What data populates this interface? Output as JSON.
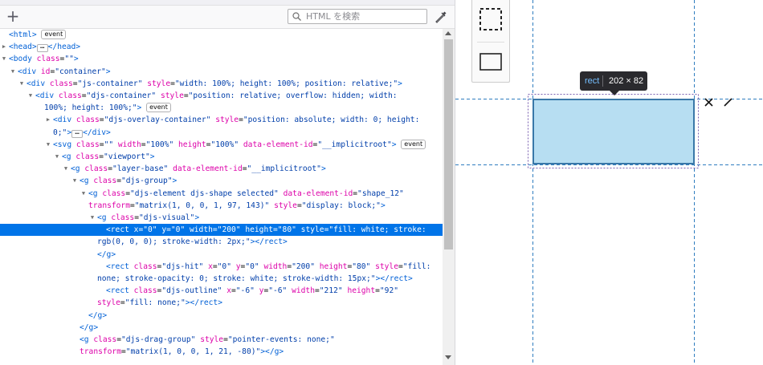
{
  "search": {
    "placeholder": "HTML を検索"
  },
  "tooltip": {
    "tag": "rect",
    "dims": "202 × 82"
  },
  "colors": {
    "selection": "#0074e8",
    "highlight_fill": "#b7def2",
    "guide": "#2f7dbf"
  },
  "lines": [
    [
      [
        "t",
        "<html>"
      ],
      [
        "x",
        " "
      ],
      [
        "b",
        "event"
      ]
    ],
    [
      [
        "t",
        "<head>"
      ],
      [
        "e",
        ""
      ],
      [
        "t",
        "</head>"
      ]
    ],
    [
      [
        "t",
        "<body "
      ],
      [
        "a",
        "class"
      ],
      [
        "p",
        "="
      ],
      [
        "v",
        "\"\""
      ],
      [
        "t",
        ">"
      ]
    ],
    [
      [
        "t",
        "<div "
      ],
      [
        "a",
        "id"
      ],
      [
        "p",
        "="
      ],
      [
        "v",
        "\"container\""
      ],
      [
        "t",
        ">"
      ]
    ],
    [
      [
        "t",
        "<div "
      ],
      [
        "a",
        "class"
      ],
      [
        "p",
        "="
      ],
      [
        "v",
        "\"js-container\""
      ],
      [
        "x",
        " "
      ],
      [
        "a",
        "style"
      ],
      [
        "p",
        "="
      ],
      [
        "v",
        "\"width: 100%; height: 100%; position: relative;\""
      ],
      [
        "t",
        ">"
      ]
    ],
    [
      [
        "t",
        "<div "
      ],
      [
        "a",
        "class"
      ],
      [
        "p",
        "="
      ],
      [
        "v",
        "\"djs-container\""
      ],
      [
        "x",
        " "
      ],
      [
        "a",
        "style"
      ],
      [
        "p",
        "="
      ],
      [
        "v",
        "\"position: relative; overflow: hidden; width:"
      ]
    ],
    [
      [
        "v",
        "100%; height: 100%;\""
      ],
      [
        "t",
        ">"
      ],
      [
        "x",
        " "
      ],
      [
        "b",
        "event"
      ]
    ],
    [
      [
        "t",
        "<div "
      ],
      [
        "a",
        "class"
      ],
      [
        "p",
        "="
      ],
      [
        "v",
        "\"djs-overlay-container\""
      ],
      [
        "x",
        " "
      ],
      [
        "a",
        "style"
      ],
      [
        "p",
        "="
      ],
      [
        "v",
        "\"position: absolute; width: 0; height:"
      ]
    ],
    [
      [
        "v",
        "0;\""
      ],
      [
        "t",
        ">"
      ],
      [
        "e",
        ""
      ],
      [
        "t",
        "</div>"
      ]
    ],
    [
      [
        "t",
        "<svg "
      ],
      [
        "a",
        "class"
      ],
      [
        "p",
        "="
      ],
      [
        "v",
        "\"\""
      ],
      [
        "x",
        " "
      ],
      [
        "a",
        "width"
      ],
      [
        "p",
        "="
      ],
      [
        "v",
        "\"100%\""
      ],
      [
        "x",
        " "
      ],
      [
        "a",
        "height"
      ],
      [
        "p",
        "="
      ],
      [
        "v",
        "\"100%\""
      ],
      [
        "x",
        " "
      ],
      [
        "a",
        "data-element-id"
      ],
      [
        "p",
        "="
      ],
      [
        "v",
        "\"__implicitroot\""
      ],
      [
        "t",
        ">"
      ],
      [
        "x",
        " "
      ],
      [
        "b",
        "event"
      ]
    ],
    [
      [
        "t",
        "<g "
      ],
      [
        "a",
        "class"
      ],
      [
        "p",
        "="
      ],
      [
        "v",
        "\"viewport\""
      ],
      [
        "t",
        ">"
      ]
    ],
    [
      [
        "t",
        "<g "
      ],
      [
        "a",
        "class"
      ],
      [
        "p",
        "="
      ],
      [
        "v",
        "\"layer-base\""
      ],
      [
        "x",
        " "
      ],
      [
        "a",
        "data-element-id"
      ],
      [
        "p",
        "="
      ],
      [
        "v",
        "\"__implicitroot\""
      ],
      [
        "t",
        ">"
      ]
    ],
    [
      [
        "t",
        "<g "
      ],
      [
        "a",
        "class"
      ],
      [
        "p",
        "="
      ],
      [
        "v",
        "\"djs-group\""
      ],
      [
        "t",
        ">"
      ]
    ],
    [
      [
        "t",
        "<g "
      ],
      [
        "a",
        "class"
      ],
      [
        "p",
        "="
      ],
      [
        "v",
        "\"djs-element djs-shape selected\""
      ],
      [
        "x",
        " "
      ],
      [
        "a",
        "data-element-id"
      ],
      [
        "p",
        "="
      ],
      [
        "v",
        "\"shape_12\""
      ]
    ],
    [
      [
        "a",
        "transform"
      ],
      [
        "p",
        "="
      ],
      [
        "v",
        "\"matrix(1, 0, 0, 1, 97, 143)\""
      ],
      [
        "x",
        " "
      ],
      [
        "a",
        "style"
      ],
      [
        "p",
        "="
      ],
      [
        "v",
        "\"display: block;\""
      ],
      [
        "t",
        ">"
      ]
    ],
    [
      [
        "t",
        "<g "
      ],
      [
        "a",
        "class"
      ],
      [
        "p",
        "="
      ],
      [
        "v",
        "\"djs-visual\""
      ],
      [
        "t",
        ">"
      ]
    ],
    [
      [
        "t",
        "<rect "
      ],
      [
        "a",
        "x"
      ],
      [
        "p",
        "="
      ],
      [
        "v",
        "\"0\""
      ],
      [
        "x",
        " "
      ],
      [
        "a",
        "y"
      ],
      [
        "p",
        "="
      ],
      [
        "v",
        "\"0\""
      ],
      [
        "x",
        " "
      ],
      [
        "a",
        "width"
      ],
      [
        "p",
        "="
      ],
      [
        "v",
        "\"200\""
      ],
      [
        "x",
        " "
      ],
      [
        "a",
        "height"
      ],
      [
        "p",
        "="
      ],
      [
        "v",
        "\"80\""
      ],
      [
        "x",
        " "
      ],
      [
        "a",
        "style"
      ],
      [
        "p",
        "="
      ],
      [
        "v",
        "\"fill: white; stroke:"
      ]
    ],
    [
      [
        "v",
        "rgb(0, 0, 0); stroke-width: 2px;\""
      ],
      [
        "t",
        "></rect>"
      ]
    ],
    [
      [
        "t",
        "</g>"
      ]
    ],
    [
      [
        "t",
        "<rect "
      ],
      [
        "a",
        "class"
      ],
      [
        "p",
        "="
      ],
      [
        "v",
        "\"djs-hit\""
      ],
      [
        "x",
        " "
      ],
      [
        "a",
        "x"
      ],
      [
        "p",
        "="
      ],
      [
        "v",
        "\"0\""
      ],
      [
        "x",
        " "
      ],
      [
        "a",
        "y"
      ],
      [
        "p",
        "="
      ],
      [
        "v",
        "\"0\""
      ],
      [
        "x",
        " "
      ],
      [
        "a",
        "width"
      ],
      [
        "p",
        "="
      ],
      [
        "v",
        "\"200\""
      ],
      [
        "x",
        " "
      ],
      [
        "a",
        "height"
      ],
      [
        "p",
        "="
      ],
      [
        "v",
        "\"80\""
      ],
      [
        "x",
        " "
      ],
      [
        "a",
        "style"
      ],
      [
        "p",
        "="
      ],
      [
        "v",
        "\"fill:"
      ]
    ],
    [
      [
        "v",
        "none; stroke-opacity: 0; stroke: white; stroke-width: 15px;\""
      ],
      [
        "t",
        "></rect>"
      ]
    ],
    [
      [
        "t",
        "<rect "
      ],
      [
        "a",
        "class"
      ],
      [
        "p",
        "="
      ],
      [
        "v",
        "\"djs-outline\""
      ],
      [
        "x",
        " "
      ],
      [
        "a",
        "x"
      ],
      [
        "p",
        "="
      ],
      [
        "v",
        "\"-6\""
      ],
      [
        "x",
        " "
      ],
      [
        "a",
        "y"
      ],
      [
        "p",
        "="
      ],
      [
        "v",
        "\"-6\""
      ],
      [
        "x",
        " "
      ],
      [
        "a",
        "width"
      ],
      [
        "p",
        "="
      ],
      [
        "v",
        "\"212\""
      ],
      [
        "x",
        " "
      ],
      [
        "a",
        "height"
      ],
      [
        "p",
        "="
      ],
      [
        "v",
        "\"92\""
      ]
    ],
    [
      [
        "a",
        "style"
      ],
      [
        "p",
        "="
      ],
      [
        "v",
        "\"fill: none;\""
      ],
      [
        "t",
        "></rect>"
      ]
    ],
    [
      [
        "t",
        "</g>"
      ]
    ],
    [
      [
        "t",
        "</g>"
      ]
    ],
    [
      [
        "t",
        "<g "
      ],
      [
        "a",
        "class"
      ],
      [
        "p",
        "="
      ],
      [
        "v",
        "\"djs-drag-group\""
      ],
      [
        "x",
        " "
      ],
      [
        "a",
        "style"
      ],
      [
        "p",
        "="
      ],
      [
        "v",
        "\"pointer-events: none;\""
      ]
    ],
    [
      [
        "a",
        "transform"
      ],
      [
        "p",
        "="
      ],
      [
        "v",
        "\"matrix(1, 0, 0, 1, 21, -80)\""
      ],
      [
        "t",
        "></g>"
      ]
    ]
  ]
}
